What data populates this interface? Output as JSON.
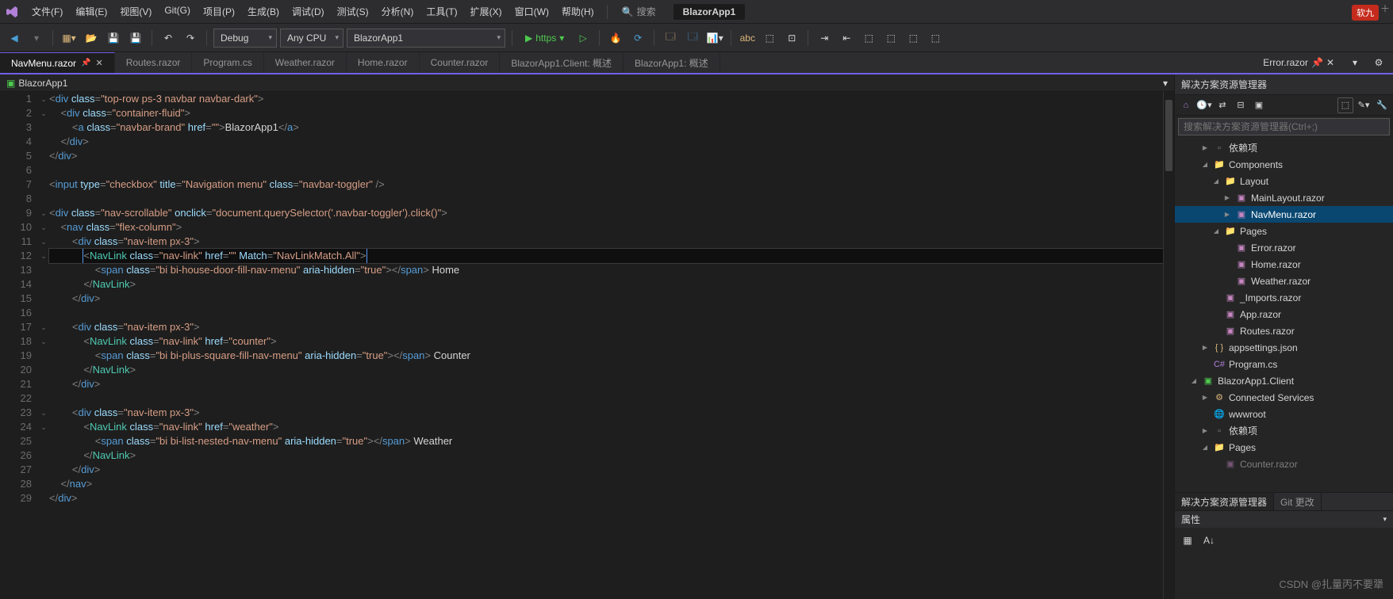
{
  "menubar": {
    "items": [
      "文件(F)",
      "编辑(E)",
      "视图(V)",
      "Git(G)",
      "项目(P)",
      "生成(B)",
      "调试(D)",
      "测试(S)",
      "分析(N)",
      "工具(T)",
      "扩展(X)",
      "窗口(W)",
      "帮助(H)"
    ],
    "search_label": "搜索",
    "app_name": "BlazorApp1",
    "badge": "软九"
  },
  "toolbar": {
    "config": "Debug",
    "platform": "Any CPU",
    "startup": "BlazorApp1",
    "launch_label": "https"
  },
  "tabs": [
    {
      "label": "NavMenu.razor",
      "active": true,
      "pinned": true,
      "closeable": true
    },
    {
      "label": "Routes.razor"
    },
    {
      "label": "Program.cs"
    },
    {
      "label": "Weather.razor"
    },
    {
      "label": "Home.razor"
    },
    {
      "label": "Counter.razor"
    },
    {
      "label": "BlazorApp1.Client: 概述"
    },
    {
      "label": "BlazorApp1: 概述"
    }
  ],
  "right_tab": {
    "label": "Error.razor"
  },
  "breadcrumb": {
    "project": "BlazorApp1"
  },
  "editor": {
    "lines": [
      {
        "n": 1,
        "fold": "v",
        "html": "<span class='t-gray'>&lt;</span><span class='t-blue'>div</span> <span class='t-lblue'>class</span><span class='t-gray'>=</span><span class='t-str'>\"top-row ps-3 navbar navbar-dark\"</span><span class='t-gray'>&gt;</span>"
      },
      {
        "n": 2,
        "fold": "v",
        "html": "    <span class='t-gray'>&lt;</span><span class='t-blue'>div</span> <span class='t-lblue'>class</span><span class='t-gray'>=</span><span class='t-str'>\"container-fluid\"</span><span class='t-gray'>&gt;</span>"
      },
      {
        "n": 3,
        "fold": "",
        "html": "        <span class='t-gray'>&lt;</span><span class='t-blue'>a</span> <span class='t-lblue'>class</span><span class='t-gray'>=</span><span class='t-str'>\"navbar-brand\"</span> <span class='t-lblue'>href</span><span class='t-gray'>=</span><span class='t-str'>\"\"</span><span class='t-gray'>&gt;</span><span class='t-text'>BlazorApp1</span><span class='t-gray'>&lt;/</span><span class='t-blue'>a</span><span class='t-gray'>&gt;</span>"
      },
      {
        "n": 4,
        "fold": "",
        "html": "    <span class='t-gray'>&lt;/</span><span class='t-blue'>div</span><span class='t-gray'>&gt;</span>"
      },
      {
        "n": 5,
        "fold": "",
        "html": "<span class='t-gray'>&lt;/</span><span class='t-blue'>div</span><span class='t-gray'>&gt;</span>"
      },
      {
        "n": 6,
        "fold": "",
        "html": ""
      },
      {
        "n": 7,
        "fold": "",
        "html": "<span class='t-gray'>&lt;</span><span class='t-blue'>input</span> <span class='t-lblue'>type</span><span class='t-gray'>=</span><span class='t-str'>\"checkbox\"</span> <span class='t-lblue'>title</span><span class='t-gray'>=</span><span class='t-str'>\"Navigation menu\"</span> <span class='t-lblue'>class</span><span class='t-gray'>=</span><span class='t-str'>\"navbar-toggler\"</span> <span class='t-gray'>/&gt;</span>"
      },
      {
        "n": 8,
        "fold": "",
        "html": ""
      },
      {
        "n": 9,
        "fold": "v",
        "html": "<span class='t-gray'>&lt;</span><span class='t-blue'>div</span> <span class='t-lblue'>class</span><span class='t-gray'>=</span><span class='t-str'>\"nav-scrollable\"</span> <span class='t-lblue'>onclick</span><span class='t-gray'>=</span><span class='t-str'>\"document.querySelector('.navbar-toggler').click()\"</span><span class='t-gray'>&gt;</span>"
      },
      {
        "n": 10,
        "fold": "v",
        "html": "    <span class='t-gray'>&lt;</span><span class='t-blue'>nav</span> <span class='t-lblue'>class</span><span class='t-gray'>=</span><span class='t-str'>\"flex-column\"</span><span class='t-gray'>&gt;</span>"
      },
      {
        "n": 11,
        "fold": "v",
        "html": "        <span class='t-gray'>&lt;</span><span class='t-blue'>div</span> <span class='t-lblue'>class</span><span class='t-gray'>=</span><span class='t-str'>\"nav-item px-3\"</span><span class='t-gray'>&gt;</span>"
      },
      {
        "n": 12,
        "fold": "v",
        "hl": true,
        "html": "            <span class='caret-box'><span class='t-gray'>&lt;</span><span class='t-teal'>NavLink</span> <span class='t-lblue'>class</span><span class='t-gray'>=</span><span class='t-str'>\"nav-link\"</span> <span class='t-lblue'>href</span><span class='t-gray'>=</span><span class='t-str'>\"\"</span> <span class='t-lblue'>Match</span><span class='t-gray'>=</span><span class='t-str'>\"NavLinkMatch.All\"</span><span class='t-gray'>&gt;</span></span>"
      },
      {
        "n": 13,
        "fold": "",
        "html": "                <span class='t-gray'>&lt;</span><span class='t-blue'>span</span> <span class='t-lblue'>class</span><span class='t-gray'>=</span><span class='t-str'>\"bi bi-house-door-fill-nav-menu\"</span> <span class='t-lblue'>aria-hidden</span><span class='t-gray'>=</span><span class='t-str'>\"true\"</span><span class='t-gray'>&gt;&lt;/</span><span class='t-blue'>span</span><span class='t-gray'>&gt;</span> <span class='t-text'>Home</span>"
      },
      {
        "n": 14,
        "fold": "",
        "html": "            <span class='t-gray'>&lt;/</span><span class='t-teal'>NavLink</span><span class='t-gray'>&gt;</span>"
      },
      {
        "n": 15,
        "fold": "",
        "html": "        <span class='t-gray'>&lt;/</span><span class='t-blue'>div</span><span class='t-gray'>&gt;</span>"
      },
      {
        "n": 16,
        "fold": "",
        "html": ""
      },
      {
        "n": 17,
        "fold": "v",
        "html": "        <span class='t-gray'>&lt;</span><span class='t-blue'>div</span> <span class='t-lblue'>class</span><span class='t-gray'>=</span><span class='t-str'>\"nav-item px-3\"</span><span class='t-gray'>&gt;</span>"
      },
      {
        "n": 18,
        "fold": "v",
        "html": "            <span class='t-gray'>&lt;</span><span class='t-teal'>NavLink</span> <span class='t-lblue'>class</span><span class='t-gray'>=</span><span class='t-str'>\"nav-link\"</span> <span class='t-lblue'>href</span><span class='t-gray'>=</span><span class='t-str'>\"counter\"</span><span class='t-gray'>&gt;</span>"
      },
      {
        "n": 19,
        "fold": "",
        "html": "                <span class='t-gray'>&lt;</span><span class='t-blue'>span</span> <span class='t-lblue'>class</span><span class='t-gray'>=</span><span class='t-str'>\"bi bi-plus-square-fill-nav-menu\"</span> <span class='t-lblue'>aria-hidden</span><span class='t-gray'>=</span><span class='t-str'>\"true\"</span><span class='t-gray'>&gt;&lt;/</span><span class='t-blue'>span</span><span class='t-gray'>&gt;</span> <span class='t-text'>Counter</span>"
      },
      {
        "n": 20,
        "fold": "",
        "html": "            <span class='t-gray'>&lt;/</span><span class='t-teal'>NavLink</span><span class='t-gray'>&gt;</span>"
      },
      {
        "n": 21,
        "fold": "",
        "html": "        <span class='t-gray'>&lt;/</span><span class='t-blue'>div</span><span class='t-gray'>&gt;</span>"
      },
      {
        "n": 22,
        "fold": "",
        "html": ""
      },
      {
        "n": 23,
        "fold": "v",
        "html": "        <span class='t-gray'>&lt;</span><span class='t-blue'>div</span> <span class='t-lblue'>class</span><span class='t-gray'>=</span><span class='t-str'>\"nav-item px-3\"</span><span class='t-gray'>&gt;</span>"
      },
      {
        "n": 24,
        "fold": "v",
        "html": "            <span class='t-gray'>&lt;</span><span class='t-teal'>NavLink</span> <span class='t-lblue'>class</span><span class='t-gray'>=</span><span class='t-str'>\"nav-link\"</span> <span class='t-lblue'>href</span><span class='t-gray'>=</span><span class='t-str'>\"weather\"</span><span class='t-gray'>&gt;</span>"
      },
      {
        "n": 25,
        "fold": "",
        "html": "                <span class='t-gray'>&lt;</span><span class='t-blue'>span</span> <span class='t-lblue'>class</span><span class='t-gray'>=</span><span class='t-str'>\"bi bi-list-nested-nav-menu\"</span> <span class='t-lblue'>aria-hidden</span><span class='t-gray'>=</span><span class='t-str'>\"true\"</span><span class='t-gray'>&gt;&lt;/</span><span class='t-blue'>span</span><span class='t-gray'>&gt;</span> <span class='t-text'>Weather</span>"
      },
      {
        "n": 26,
        "fold": "",
        "html": "            <span class='t-gray'>&lt;/</span><span class='t-teal'>NavLink</span><span class='t-gray'>&gt;</span>"
      },
      {
        "n": 27,
        "fold": "",
        "html": "        <span class='t-gray'>&lt;/</span><span class='t-blue'>div</span><span class='t-gray'>&gt;</span>"
      },
      {
        "n": 28,
        "fold": "",
        "html": "    <span class='t-gray'>&lt;/</span><span class='t-blue'>nav</span><span class='t-gray'>&gt;</span>"
      },
      {
        "n": 29,
        "fold": "",
        "html": "<span class='t-gray'>&lt;/</span><span class='t-blue'>div</span><span class='t-gray'>&gt;</span>"
      }
    ]
  },
  "solexp": {
    "title": "解决方案资源管理器",
    "search_placeholder": "搜索解决方案资源管理器(Ctrl+;)",
    "tree": [
      {
        "depth": 0,
        "exp": "▶",
        "ico": "ref",
        "label": "依赖项"
      },
      {
        "depth": 0,
        "exp": "◢",
        "ico": "folder",
        "label": "Components"
      },
      {
        "depth": 1,
        "exp": "◢",
        "ico": "folder",
        "label": "Layout"
      },
      {
        "depth": 2,
        "exp": "▶",
        "ico": "razor",
        "label": "MainLayout.razor"
      },
      {
        "depth": 2,
        "exp": "▶",
        "ico": "razor",
        "label": "NavMenu.razor",
        "selected": true
      },
      {
        "depth": 1,
        "exp": "◢",
        "ico": "folder",
        "label": "Pages"
      },
      {
        "depth": 2,
        "exp": "",
        "ico": "razor",
        "label": "Error.razor"
      },
      {
        "depth": 2,
        "exp": "",
        "ico": "razor",
        "label": "Home.razor"
      },
      {
        "depth": 2,
        "exp": "",
        "ico": "razor",
        "label": "Weather.razor"
      },
      {
        "depth": 1,
        "exp": "",
        "ico": "razor",
        "label": "_Imports.razor"
      },
      {
        "depth": 1,
        "exp": "",
        "ico": "razor",
        "label": "App.razor"
      },
      {
        "depth": 1,
        "exp": "",
        "ico": "razor",
        "label": "Routes.razor"
      },
      {
        "depth": 0,
        "exp": "▶",
        "ico": "json",
        "label": "appsettings.json"
      },
      {
        "depth": 0,
        "exp": "",
        "ico": "cs",
        "label": "Program.cs"
      },
      {
        "depth": -1,
        "exp": "◢",
        "ico": "proj",
        "label": "BlazorApp1.Client"
      },
      {
        "depth": 0,
        "exp": "▶",
        "ico": "conn",
        "label": "Connected Services"
      },
      {
        "depth": 0,
        "exp": "",
        "ico": "world",
        "label": "wwwroot"
      },
      {
        "depth": 0,
        "exp": "▶",
        "ico": "ref",
        "label": "依赖项"
      },
      {
        "depth": 0,
        "exp": "◢",
        "ico": "folder",
        "label": "Pages"
      },
      {
        "depth": 1,
        "exp": "",
        "ico": "razor",
        "label": "Counter.razor",
        "dim": true
      }
    ],
    "bottom_tabs": {
      "active": "解决方案资源管理器",
      "other": "Git 更改"
    },
    "props_title": "属性"
  },
  "watermark": "CSDN @扎量丙不要犟"
}
